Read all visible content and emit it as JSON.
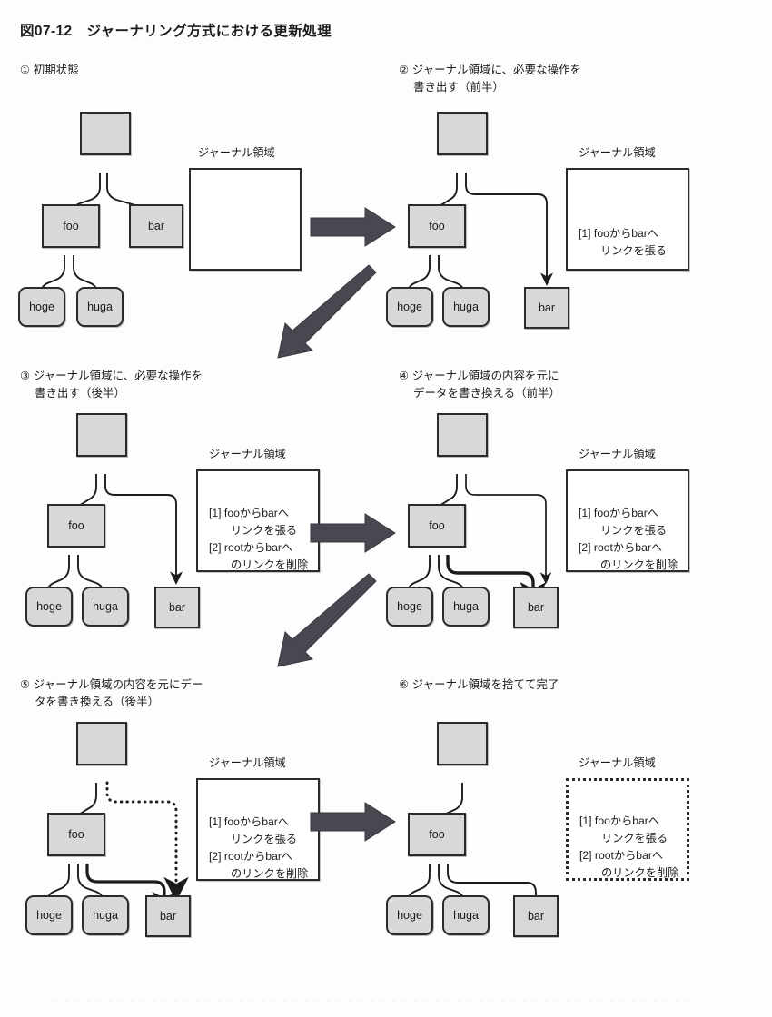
{
  "figure": {
    "title": "図07-12　ジャーナリング方式における更新処理"
  },
  "labels": {
    "journal_area": "ジャーナル領域",
    "node_root": "",
    "node_foo": "foo",
    "node_bar": "bar",
    "node_hoge": "hoge",
    "node_huga": "huga"
  },
  "journal_entries": {
    "entry1_line1": "[1] fooからbarへ",
    "entry1_line2": "リンクを張る",
    "entry2_line1": "[2] rootからbarへ",
    "entry2_line2": "のリンクを削除"
  },
  "panels": [
    {
      "id": "panel-1",
      "marker": "①",
      "caption": "① 初期状態",
      "journal_state": "empty",
      "journal_border": "solid"
    },
    {
      "id": "panel-2",
      "marker": "②",
      "caption": "② ジャーナル領域に、必要な操作を\n　 書き出す（前半）",
      "journal_state": "entry1",
      "journal_border": "solid"
    },
    {
      "id": "panel-3",
      "marker": "③",
      "caption": "③ ジャーナル領域に、必要な操作を\n　 書き出す（後半）",
      "journal_state": "entry1+entry2",
      "journal_border": "solid"
    },
    {
      "id": "panel-4",
      "marker": "④",
      "caption": "④ ジャーナル領域の内容を元に\n　 データを書き換える（前半）",
      "journal_state": "entry1+entry2",
      "journal_border": "solid"
    },
    {
      "id": "panel-5",
      "marker": "⑤",
      "caption": "⑤ ジャーナル領域の内容を元にデー\n　 タを書き換える（後半）",
      "journal_state": "entry1+entry2",
      "journal_border": "solid"
    },
    {
      "id": "panel-6",
      "marker": "⑥",
      "caption": "⑥ ジャーナル領域を捨てて完了",
      "journal_state": "entry1+entry2",
      "journal_border": "dotted"
    }
  ],
  "flow_arrows": [
    {
      "name": "arrow-1-to-2",
      "direction": "right"
    },
    {
      "name": "arrow-2-to-3",
      "direction": "down-left"
    },
    {
      "name": "arrow-3-to-4",
      "direction": "right"
    },
    {
      "name": "arrow-4-to-5",
      "direction": "down-left"
    },
    {
      "name": "arrow-5-to-6",
      "direction": "right"
    }
  ],
  "colors": {
    "node_fill": "#d8d8d8",
    "stroke": "#2b2b2b",
    "flow_arrow": "#4a4750",
    "background": "#fdfdfd",
    "text": "#1b1b1b"
  }
}
